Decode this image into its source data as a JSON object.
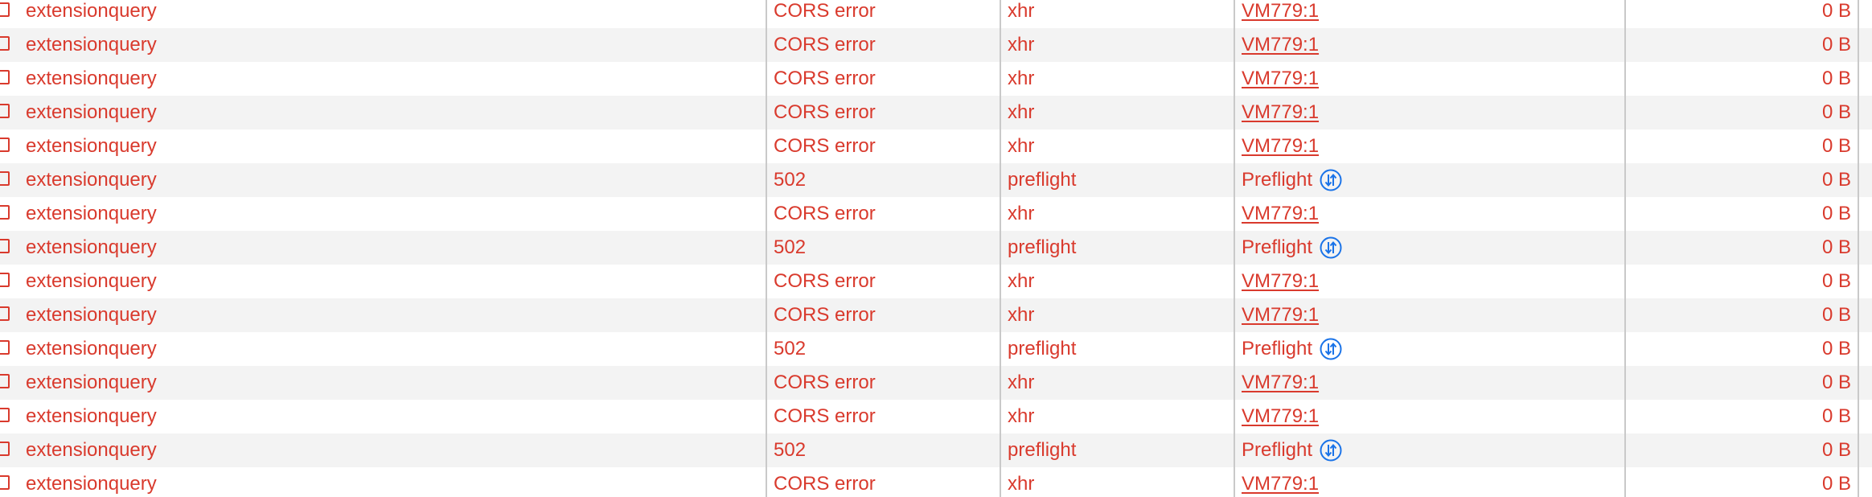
{
  "colors": {
    "error_text": "#d93a2d",
    "alt_row_bg": "#f3f3f3",
    "preflight_icon": "#1a73e8",
    "separator": "#c9c9c9"
  },
  "requests": [
    {
      "name": "extensionquery",
      "status": "CORS error",
      "type": "xhr",
      "initiator": "VM779:1",
      "initiator_kind": "link",
      "size": "0 B"
    },
    {
      "name": "extensionquery",
      "status": "CORS error",
      "type": "xhr",
      "initiator": "VM779:1",
      "initiator_kind": "link",
      "size": "0 B"
    },
    {
      "name": "extensionquery",
      "status": "CORS error",
      "type": "xhr",
      "initiator": "VM779:1",
      "initiator_kind": "link",
      "size": "0 B"
    },
    {
      "name": "extensionquery",
      "status": "CORS error",
      "type": "xhr",
      "initiator": "VM779:1",
      "initiator_kind": "link",
      "size": "0 B"
    },
    {
      "name": "extensionquery",
      "status": "CORS error",
      "type": "xhr",
      "initiator": "VM779:1",
      "initiator_kind": "link",
      "size": "0 B"
    },
    {
      "name": "extensionquery",
      "status": "502",
      "type": "preflight",
      "initiator": "Preflight",
      "initiator_kind": "preflight",
      "initiator_icon": "preflight-arrows-icon",
      "size": "0 B"
    },
    {
      "name": "extensionquery",
      "status": "CORS error",
      "type": "xhr",
      "initiator": "VM779:1",
      "initiator_kind": "link",
      "size": "0 B"
    },
    {
      "name": "extensionquery",
      "status": "502",
      "type": "preflight",
      "initiator": "Preflight",
      "initiator_kind": "preflight",
      "initiator_icon": "preflight-arrows-icon",
      "size": "0 B"
    },
    {
      "name": "extensionquery",
      "status": "CORS error",
      "type": "xhr",
      "initiator": "VM779:1",
      "initiator_kind": "link",
      "size": "0 B"
    },
    {
      "name": "extensionquery",
      "status": "CORS error",
      "type": "xhr",
      "initiator": "VM779:1",
      "initiator_kind": "link",
      "size": "0 B"
    },
    {
      "name": "extensionquery",
      "status": "502",
      "type": "preflight",
      "initiator": "Preflight",
      "initiator_kind": "preflight",
      "initiator_icon": "preflight-arrows-icon",
      "size": "0 B"
    },
    {
      "name": "extensionquery",
      "status": "CORS error",
      "type": "xhr",
      "initiator": "VM779:1",
      "initiator_kind": "link",
      "size": "0 B"
    },
    {
      "name": "extensionquery",
      "status": "CORS error",
      "type": "xhr",
      "initiator": "VM779:1",
      "initiator_kind": "link",
      "size": "0 B"
    },
    {
      "name": "extensionquery",
      "status": "502",
      "type": "preflight",
      "initiator": "Preflight",
      "initiator_kind": "preflight",
      "initiator_icon": "preflight-arrows-icon",
      "size": "0 B"
    },
    {
      "name": "extensionquery",
      "status": "CORS error",
      "type": "xhr",
      "initiator": "VM779:1",
      "initiator_kind": "link",
      "size": "0 B"
    }
  ]
}
